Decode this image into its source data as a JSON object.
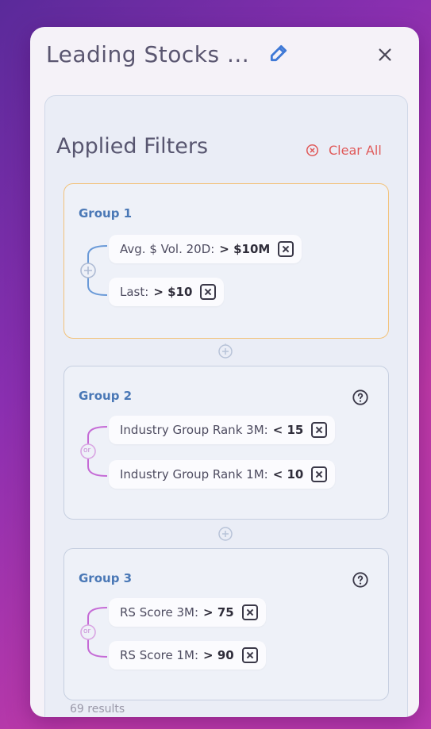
{
  "header": {
    "title": "Leading Stocks ..."
  },
  "filters": {
    "title": "Applied Filters",
    "clear_label": "Clear All",
    "groups": [
      {
        "label": "Group 1",
        "operator": "",
        "items": [
          {
            "label": "Avg. $ Vol. 20D:",
            "value": "> $10M"
          },
          {
            "label": "Last:",
            "value": "> $10"
          }
        ]
      },
      {
        "label": "Group 2",
        "operator": "or",
        "items": [
          {
            "label": "Industry Group Rank 3M:",
            "value": "< 15"
          },
          {
            "label": "Industry Group Rank 1M:",
            "value": "< 10"
          }
        ]
      },
      {
        "label": "Group 3",
        "operator": "or",
        "items": [
          {
            "label": "RS Score 3M:",
            "value": "> 75"
          },
          {
            "label": "RS Score 1M:",
            "value": "> 90"
          }
        ]
      }
    ]
  },
  "footer": {
    "results": "69 results"
  },
  "colors": {
    "accent_blue": "#4a78b6",
    "clear_red": "#e05a5a",
    "group_active_border": "#f2c27a",
    "or_connector": "#c56bd6",
    "and_connector": "#6a9ad8"
  },
  "icons": {
    "edit": "edit-icon",
    "close": "close-icon",
    "clear": "clear-circle-icon",
    "help": "question-circle-icon",
    "plus": "plus-circle-icon"
  }
}
